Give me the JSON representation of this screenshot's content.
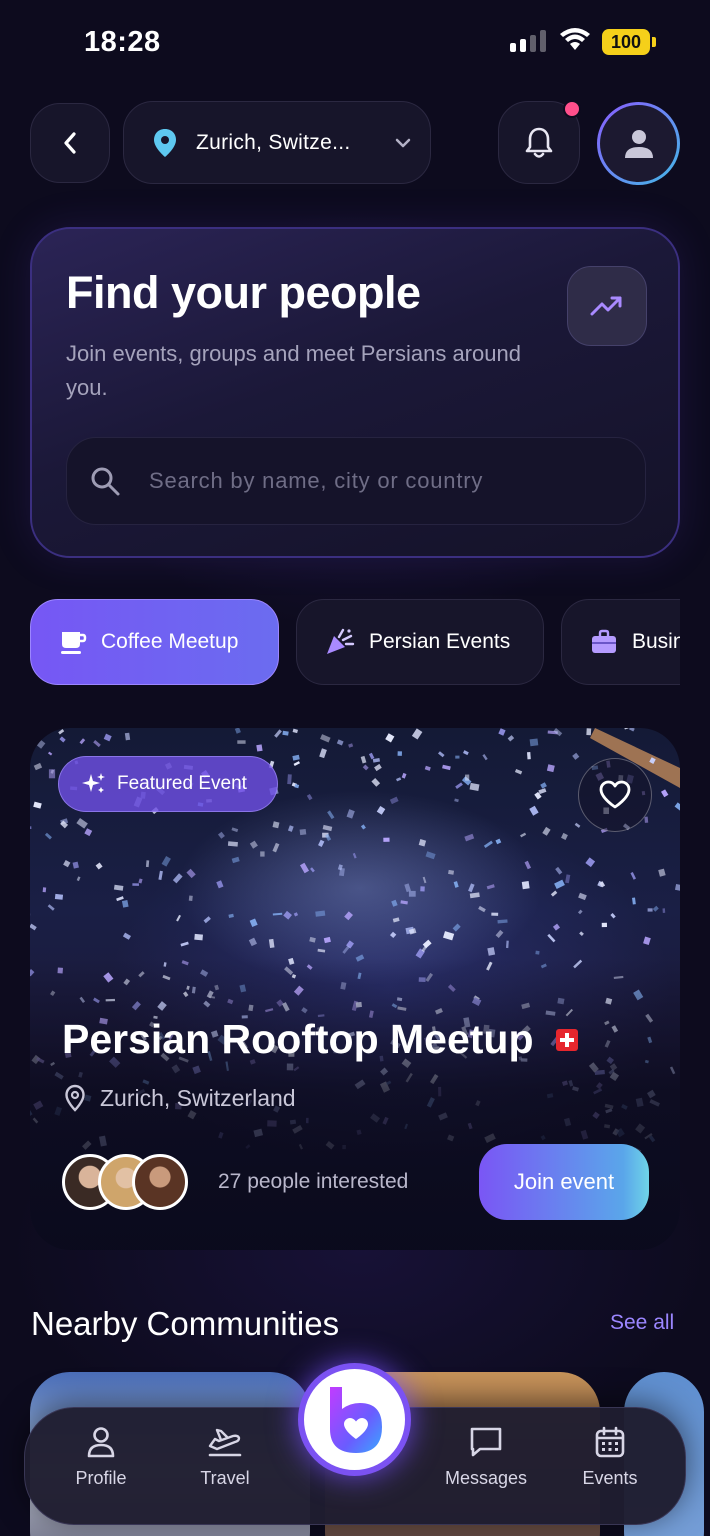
{
  "status_bar": {
    "time": "18:28",
    "battery": "100"
  },
  "header": {
    "location": "Zurich, Switze..."
  },
  "hero": {
    "title": "Find your people",
    "subtitle": "Join events, groups and meet Persians around you.",
    "search_placeholder": "Search by name, city or country"
  },
  "categories": [
    {
      "label": "Coffee Meetup",
      "icon": "coffee-cup-icon",
      "active": true
    },
    {
      "label": "Persian Events",
      "icon": "party-popper-icon",
      "active": false
    },
    {
      "label": "Business",
      "icon": "briefcase-icon",
      "active": false
    }
  ],
  "featured_event": {
    "badge": "Featured Event",
    "title": "Persian Rooftop Meetup",
    "location": "Zurich, Switzerland",
    "interested": "27 people interested",
    "cta": "Join event"
  },
  "nearby": {
    "title": "Nearby Communities",
    "see_all": "See all"
  },
  "tabbar": {
    "profile": "Profile",
    "travel": "Travel",
    "messages": "Messages",
    "events": "Events"
  },
  "colors": {
    "background": "#0d0b1e",
    "accent": "#7657f4",
    "accent_light": "#9b86ff",
    "notification": "#ff4f8b",
    "battery": "#f5d01a"
  }
}
